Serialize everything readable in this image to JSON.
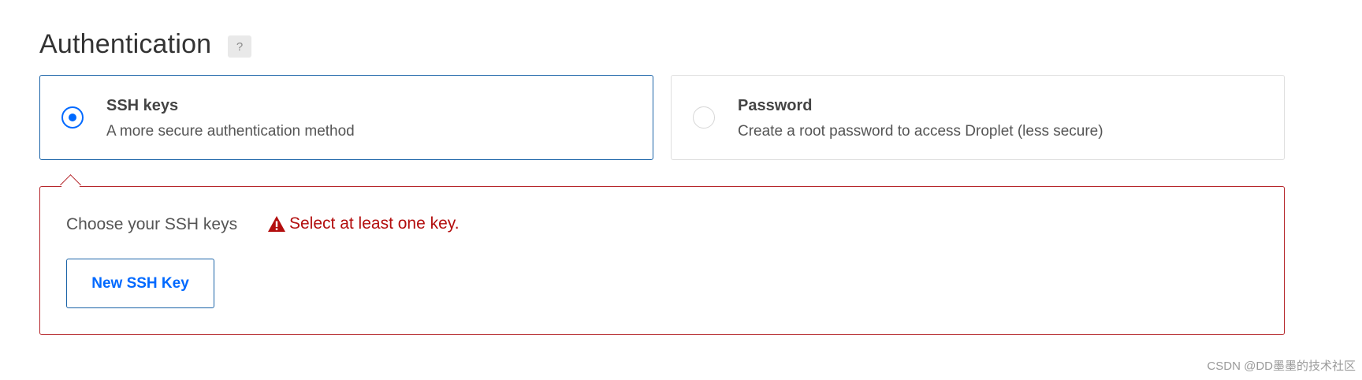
{
  "section": {
    "title": "Authentication",
    "help_label": "?"
  },
  "options": [
    {
      "title": "SSH keys",
      "description": "A more secure authentication method",
      "selected": true
    },
    {
      "title": "Password",
      "description": "Create a root password to access Droplet (less secure)",
      "selected": false
    }
  ],
  "ssh_panel": {
    "label": "Choose your SSH keys",
    "error_icon": "warning-triangle-icon",
    "error_text": "Select at least one key.",
    "new_key_button": "New SSH Key"
  },
  "watermark": "CSDN @DD墨墨的技术社区",
  "colors": {
    "accent": "#0069ff",
    "selected_border": "#1b64a8",
    "error": "#b30e0e",
    "error_border": "#b5252a"
  }
}
